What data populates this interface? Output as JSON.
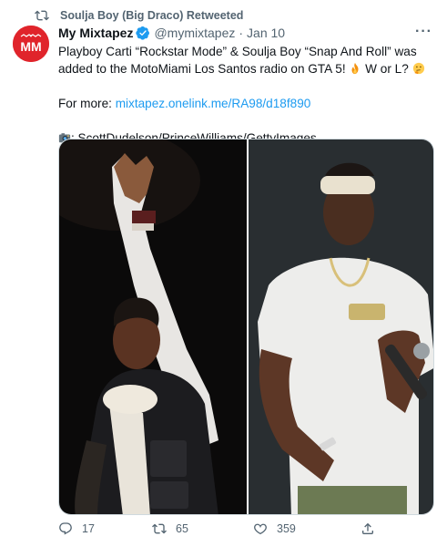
{
  "retweet": {
    "text": "Soulja Boy (Big Draco) Retweeted"
  },
  "author": {
    "name": "My Mixtapez",
    "handle": "@mymixtapez",
    "separator": "·",
    "date": "Jan 10",
    "avatar_logo": "MM"
  },
  "more_label": "···",
  "text": {
    "line1_a": "Playboy Carti “Rockstar Mode” & Soulja Boy “Snap And Roll” was added to the MotoMiami Los Santos radio on GTA 5!",
    "line1_b": "W or L?",
    "more_prefix": "For more:",
    "more_link": "mixtapez.onelink.me/RA98/d18f890",
    "credit": ": ScottDudelson/PrinceWilliams/GettyImages"
  },
  "icons": {
    "retweeted": "retweet-icon",
    "verified": "verified-badge-icon",
    "fire": "fire-emoji",
    "thinking": "thinking-emoji",
    "camera": "camera-emoji",
    "reply": "reply-icon",
    "retweet": "retweet-icon",
    "like": "like-icon",
    "share": "share-icon"
  },
  "actions": {
    "replies": "17",
    "retweets": "65",
    "likes": "359"
  },
  "colors": {
    "accent": "#1d9bf0",
    "muted": "#536471",
    "avatar_bg": "#e0242b"
  }
}
